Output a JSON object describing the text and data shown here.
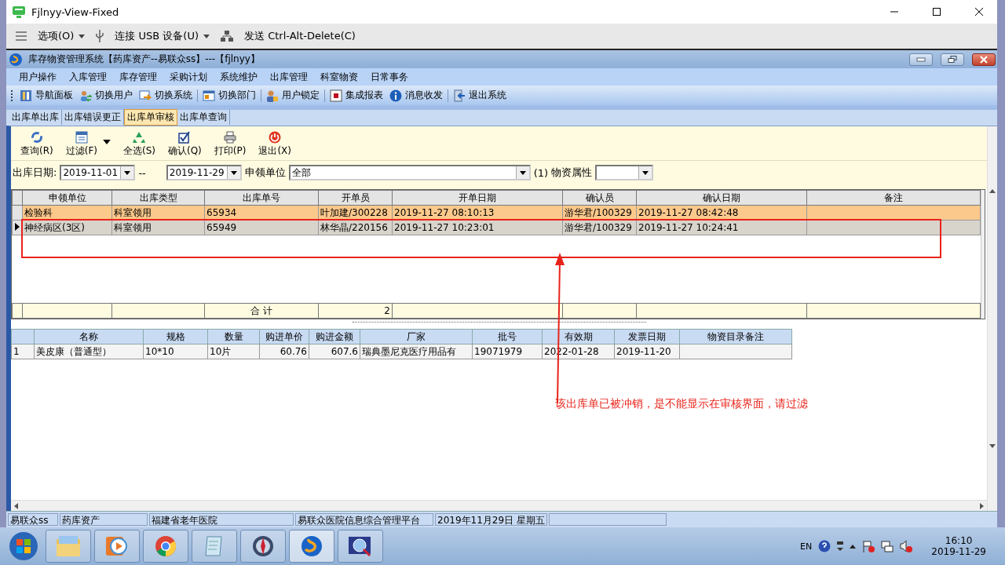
{
  "remote_window": {
    "title": "Fjlnyy-View-Fixed",
    "menu": [
      {
        "label": "选项(O)",
        "caret": true
      },
      {
        "label": "连接 USB 设备(U)",
        "caret": true
      },
      {
        "label": "发送 Ctrl-Alt-Delete(C)",
        "caret": false
      }
    ]
  },
  "app": {
    "title": "库存物资管理系统【药库资产--易联众ss】---【fjlnyy】",
    "menu": [
      "用户操作",
      "入库管理",
      "库存管理",
      "采购计划",
      "系统维护",
      "出库管理",
      "科室物资",
      "日常事务"
    ],
    "toolbar": [
      "导航面板",
      "切换用户",
      "切换系统",
      "切换部门",
      "用户锁定",
      "集成报表",
      "消息收发",
      "退出系统"
    ],
    "tabs": [
      {
        "label": "出库单出库",
        "selected": false
      },
      {
        "label": "出库错误更正",
        "selected": false
      },
      {
        "label": "出库单审核",
        "selected": true
      },
      {
        "label": "出库单查询",
        "selected": false
      }
    ],
    "actions": [
      {
        "label": "查询(R)",
        "caret": false
      },
      {
        "label": "过滤(F)",
        "caret": true
      },
      {
        "label": "全选(S)",
        "caret": false
      },
      {
        "label": "确认(Q)",
        "caret": false
      },
      {
        "label": "打印(P)",
        "caret": false
      },
      {
        "label": "退出(X)",
        "caret": false
      }
    ],
    "filter": {
      "date_label": "出库日期:",
      "date_from": "2019-11-01",
      "separator": "--",
      "date_to": "2019-11-29",
      "unit_label": "申领单位",
      "unit_value": "全部",
      "count": "(1)",
      "attr_label": "物资属性"
    },
    "grid": {
      "columns": [
        "申领单位",
        "出库类型",
        "出库单号",
        "开单员",
        "开单日期",
        "确认员",
        "确认日期",
        "备注"
      ],
      "rows": [
        {
          "selected": true,
          "current": false,
          "cells": [
            "检验科",
            "科室领用",
            "65934",
            "叶加建/300228",
            "2019-11-27  08:10:13",
            "游华君/100329",
            "2019-11-27  08:42:48",
            ""
          ]
        },
        {
          "selected": false,
          "current": true,
          "cells": [
            "神经病区(3区)",
            "科室领用",
            "65949",
            "林华晶/220156",
            "2019-11-27  10:23:01",
            "游华君/100329",
            "2019-11-27  10:24:41",
            ""
          ]
        }
      ],
      "totals": {
        "label": "合 计",
        "count": "2"
      }
    },
    "detail": {
      "columns": [
        "名称",
        "规格",
        "数量",
        "购进单价",
        "购进金额",
        "厂家",
        "批号",
        "有效期",
        "发票日期",
        "物资目录备注"
      ],
      "rows": [
        {
          "index": "1",
          "cells": [
            "美皮康（普通型）",
            "10*10",
            "10片",
            "60.76",
            "607.6",
            "瑞典墨尼克医疗用品有",
            "19071979",
            "2022-01-28",
            "2019-11-20",
            ""
          ]
        }
      ]
    },
    "status_bar": [
      "易联众ss",
      "药库资产",
      "福建省老年医院",
      "易联众医院信息综合管理平台",
      "2019年11月29日  星期五"
    ]
  },
  "annotation": {
    "text": "该出库单已被冲销，是不能显示在审核界面，请过滤"
  },
  "taskbar": {
    "language": "EN",
    "time": "16:10",
    "date": "2019-11-29"
  }
}
